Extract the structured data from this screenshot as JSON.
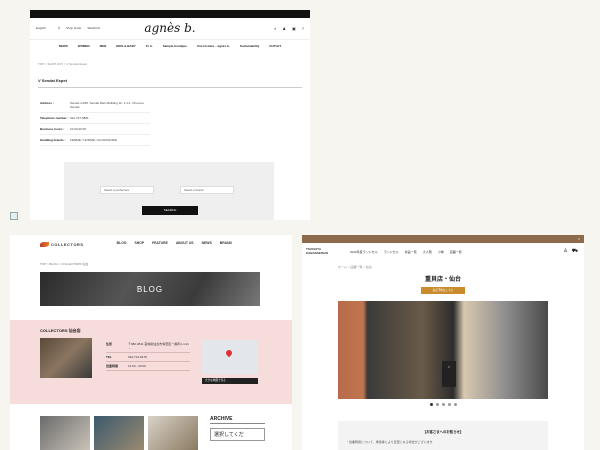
{
  "panel_a": {
    "topbar_text": "",
    "language": "English",
    "region_label": "",
    "store_finder_label": "Shop finder",
    "search_label": "SEARCH",
    "logo": "agnès b.",
    "nav": [
      "NEWS",
      "WOMEN",
      "MEN",
      "KIDS & BABY",
      "To b.",
      "Sample boutique",
      "Une histoire... agnès b.",
      "Sustainability",
      "OUTLET"
    ],
    "breadcrumb": "TOP > SHOP LIST > V Sendai Espet",
    "store_title": "V Sendai Espet",
    "info": [
      {
        "k": "Address :",
        "v": "Sendai 4-F#6, Sendai Main Building 1F, 1-1-1, Chuo-ku, Sendai"
      },
      {
        "k": "Telephone number :",
        "v": "022-797-9881"
      },
      {
        "k": "Business hours :",
        "v": "10:00-20:00"
      },
      {
        "k": "Handling brands :",
        "v": "FEMME / HOMME / ACCESSOIRE"
      }
    ],
    "select_prefecture": "Select a prefecture",
    "select_brand": "Select a brand",
    "search_button": "SEARCH"
  },
  "panel_b": {
    "logo": "COLLECTORS",
    "menu": [
      "BLOG",
      "SHOP",
      "FEATURE",
      "ABOUT US",
      "NEWS",
      "BRAND"
    ],
    "breadcrumb": "TOP > BLOG > COLLECTORS 仙台",
    "banner": "BLOG",
    "shop_name": "COLLECTORS 仙台店",
    "table": [
      {
        "k": "住所",
        "v": "〒980-0811 宮城県仙台市青葉区一番町4-4-11 ..."
      },
      {
        "k": "TEL",
        "v": "022-713-9278"
      },
      {
        "k": "営業時間",
        "v": "12:00 - 20:00"
      }
    ],
    "map_button": "大きな地図で見る",
    "archive_title": "ARCHIVE",
    "archive_select": "選択してくだ"
  },
  "panel_c": {
    "topbar_text": "",
    "logo_line1": "TSUCHIYA",
    "logo_line2": "KABANSEISHO",
    "nav": [
      "2026年度ランドセル",
      "ランドセル",
      "商品一覧",
      "大人鞄",
      "小物",
      "店舗一覧"
    ],
    "breadcrumb": "ホーム > 店舗一覧 > 仙台",
    "title": "重貝店・仙台",
    "reserve_button": "来店予約はこちら",
    "notice_heading": "【お客さまへのお知らせ】",
    "notice_body": "・営業時間について、季節等により変更となる場合がございます"
  },
  "colors": {
    "agnes_topbar": "#111111",
    "collectors_pink": "#f7dcdc",
    "tsuchiya_brown": "#8c6a4a",
    "tsuchiya_button": "#c88c2c"
  }
}
